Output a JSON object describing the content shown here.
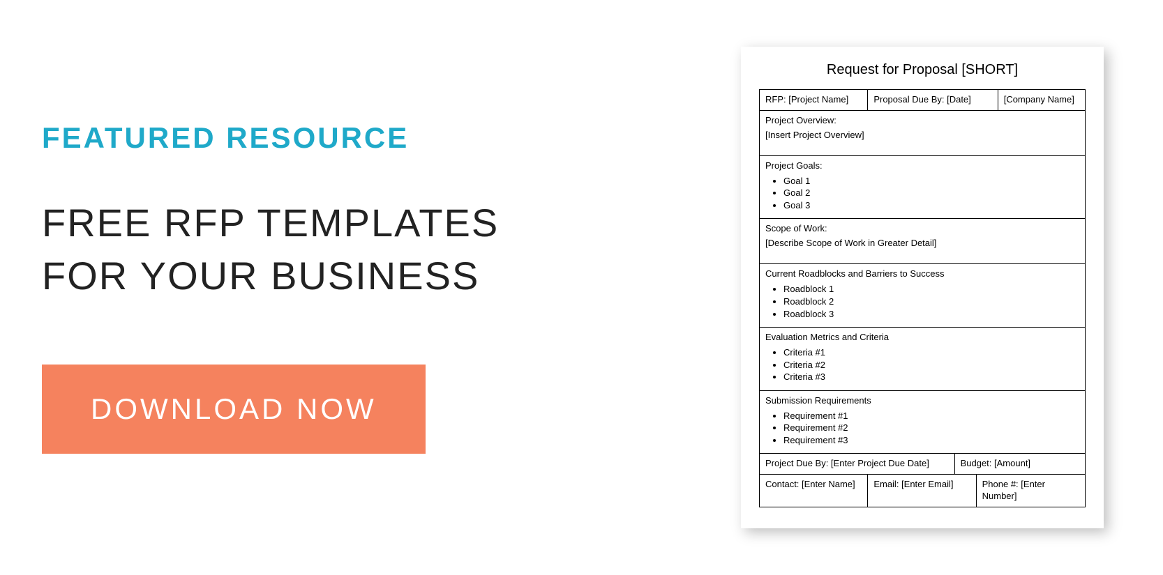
{
  "left": {
    "eyebrow": "FEATURED RESOURCE",
    "headline": "FREE RFP TEMPLATES FOR YOUR BUSINESS",
    "cta_label": "DOWNLOAD NOW"
  },
  "doc": {
    "title": "Request for Proposal [SHORT]",
    "header_row": {
      "rfp": "RFP: [Project Name]",
      "due": "Proposal Due By: [Date]",
      "company": "[Company Name]"
    },
    "overview": {
      "label": "Project Overview:",
      "body": "[Insert Project Overview]"
    },
    "goals": {
      "label": "Project Goals:",
      "items": [
        "Goal 1",
        "Goal 2",
        "Goal 3"
      ]
    },
    "scope": {
      "label": "Scope of Work:",
      "body": "[Describe Scope of Work in Greater Detail]"
    },
    "roadblocks": {
      "label": "Current Roadblocks and Barriers to Success",
      "items": [
        "Roadblock 1",
        "Roadblock 2",
        "Roadblock 3"
      ]
    },
    "criteria": {
      "label": "Evaluation Metrics and Criteria",
      "items": [
        "Criteria #1",
        "Criteria #2",
        "Criteria #3"
      ]
    },
    "requirements": {
      "label": "Submission Requirements",
      "items": [
        "Requirement #1",
        "Requirement #2",
        "Requirement #3"
      ]
    },
    "footer1": {
      "due": "Project Due By: [Enter Project Due Date]",
      "budget": "Budget: [Amount]"
    },
    "footer2": {
      "contact": "Contact: [Enter Name]",
      "email": "Email: [Enter Email]",
      "phone": "Phone #: [Enter Number]"
    }
  }
}
